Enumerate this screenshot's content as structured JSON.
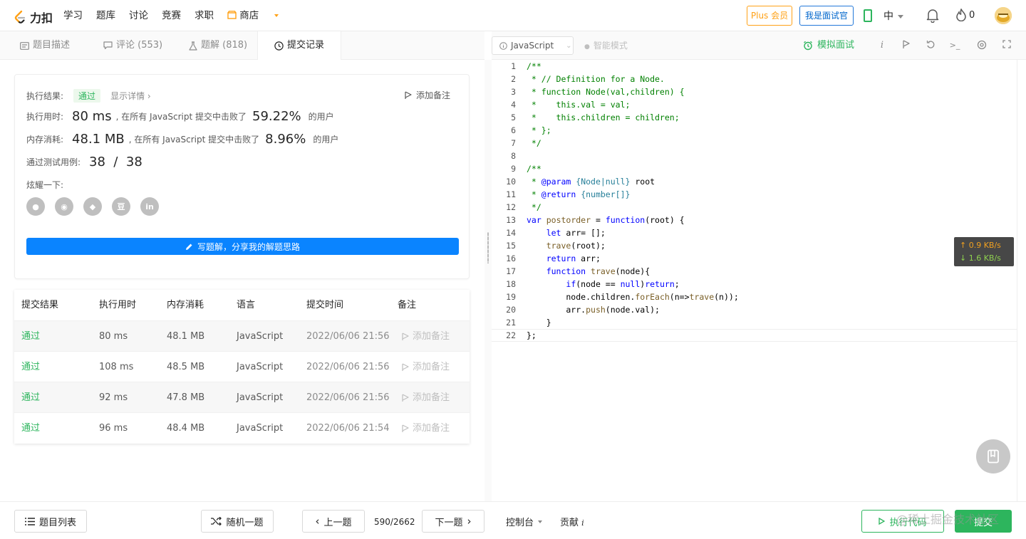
{
  "header": {
    "logo_text": "力扣",
    "nav": [
      "学习",
      "题库",
      "讨论",
      "竞赛",
      "求职"
    ],
    "shop": "商店",
    "plus": "Plus 会员",
    "interviewer": "我是面试官",
    "lang": "中",
    "fire_count": "0"
  },
  "tabs": {
    "desc": "题目描述",
    "comments": "评论 (553)",
    "solutions": "题解 (818)",
    "submissions": "提交记录"
  },
  "result": {
    "label_result": "执行结果:",
    "status": "通过",
    "detail": "显示详情",
    "add_note": "添加备注",
    "label_time": "执行用时:",
    "time_value": "80 ms",
    "time_desc": ", 在所有 JavaScript 提交中击败了",
    "time_pct": "59.22%",
    "users": "的用户",
    "label_mem": "内存消耗:",
    "mem_value": "48.1 MB",
    "mem_desc": ", 在所有 JavaScript 提交中击败了",
    "mem_pct": "8.96%",
    "label_cases": "通过测试用例:",
    "cases_value": "38  /  38",
    "label_share": "炫耀一下:",
    "share_icons": [
      "wechat-icon",
      "weibo-icon",
      "qq-icon",
      "douban-icon",
      "linkedin-icon"
    ],
    "share_glyphs": [
      "●",
      "◉",
      "◆",
      "豆",
      "in"
    ],
    "write_btn": "写题解，分享我的解题思路"
  },
  "submissions": {
    "headers": [
      "提交结果",
      "执行用时",
      "内存消耗",
      "语言",
      "提交时间",
      "备注"
    ],
    "rows": [
      {
        "status": "通过",
        "time": "80 ms",
        "mem": "48.1 MB",
        "lang": "JavaScript",
        "date": "2022/06/06 21:56",
        "note": "添加备注"
      },
      {
        "status": "通过",
        "time": "108 ms",
        "mem": "48.5 MB",
        "lang": "JavaScript",
        "date": "2022/06/06 21:56",
        "note": "添加备注"
      },
      {
        "status": "通过",
        "time": "92 ms",
        "mem": "47.8 MB",
        "lang": "JavaScript",
        "date": "2022/06/06 21:56",
        "note": "添加备注"
      },
      {
        "status": "通过",
        "time": "96 ms",
        "mem": "48.4 MB",
        "lang": "JavaScript",
        "date": "2022/06/06 21:54",
        "note": "添加备注"
      }
    ]
  },
  "editor": {
    "language": "JavaScript",
    "smart_mode": "智能模式",
    "mock_interview": "模拟面试",
    "line_numbers": [
      "1",
      "2",
      "3",
      "4",
      "5",
      "6",
      "7",
      "8",
      "9",
      "10",
      "11",
      "12",
      "13",
      "14",
      "15",
      "16",
      "17",
      "18",
      "19",
      "20",
      "21",
      "22"
    ]
  },
  "network": {
    "up": "↑ 0.9 KB/s",
    "down": "↓ 1.6 KB/s"
  },
  "footer": {
    "list": "题目列表",
    "random": "随机一题",
    "prev": "上一题",
    "page": "590/2662",
    "next": "下一题",
    "console": "控制台",
    "contrib": "贡献",
    "run": "执行代码",
    "submit": "提交",
    "watermark": "@稀土掘金技术社区"
  }
}
